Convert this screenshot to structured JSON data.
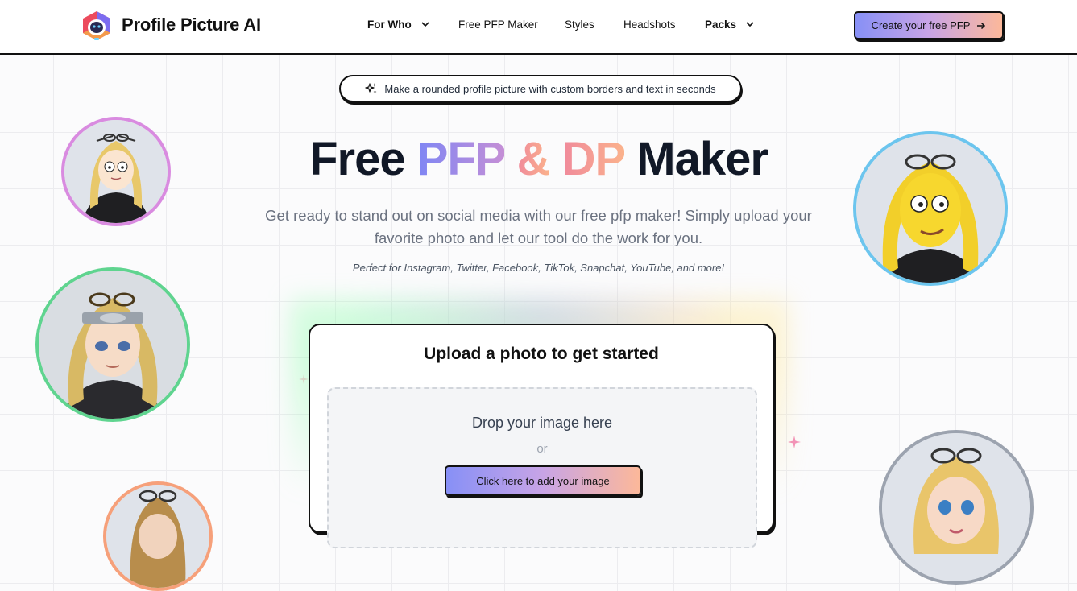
{
  "header": {
    "brand": "Profile Picture AI",
    "nav": [
      {
        "label": "For Who",
        "has_dropdown": true
      },
      {
        "label": "Free PFP Maker",
        "has_dropdown": false
      },
      {
        "label": "Styles",
        "has_dropdown": false
      },
      {
        "label": "Headshots",
        "has_dropdown": false
      },
      {
        "label": "Packs",
        "has_dropdown": true
      }
    ],
    "cta_label": "Create your free PFP"
  },
  "hero": {
    "badge": "Make a rounded profile picture with custom borders and text in seconds",
    "title_part1": "Free",
    "title_part2": "PFP",
    "title_part3": "&",
    "title_part4": "DP",
    "title_part5": "Maker",
    "subtitle": "Get ready to stand out on social media with our free pfp maker! Simply upload your favorite photo and let our tool do the work for you.",
    "platforms": "Perfect for Instagram, Twitter, Facebook, TikTok, Snapchat, YouTube, and more!"
  },
  "upload": {
    "title": "Upload a photo to get started",
    "drop_text": "Drop your image here",
    "or_text": "or",
    "button_label": "Click here to add your image"
  },
  "avatars": [
    {
      "style": "cartoon",
      "border_color": "#d98be0"
    },
    {
      "style": "anime",
      "border_color": "#5fd48f"
    },
    {
      "style": "yellow-cartoon",
      "border_color": "#6cc5ee"
    },
    {
      "style": "3d-doll",
      "border_color": "#9ca3af"
    },
    {
      "style": "partial",
      "border_color": "#f6a07a"
    }
  ],
  "colors": {
    "accent_start": "#8790f6",
    "accent_end": "#fcb89a"
  }
}
